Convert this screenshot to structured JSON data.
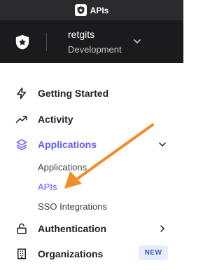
{
  "window": {
    "title": "APIs"
  },
  "tenant": {
    "name": "retgits",
    "environment": "Development"
  },
  "nav": {
    "items": [
      {
        "label": "Getting Started",
        "icon": "lightning-icon"
      },
      {
        "label": "Activity",
        "icon": "trending-up-icon"
      },
      {
        "label": "Applications",
        "icon": "layers-icon",
        "expanded": true,
        "active": true
      },
      {
        "label": "Authentication",
        "icon": "lock-icon",
        "expanded": false
      },
      {
        "label": "Organizations",
        "icon": "building-icon",
        "badge": "NEW"
      }
    ],
    "subitems": [
      {
        "label": "Applications"
      },
      {
        "label": "APIs",
        "active": true
      },
      {
        "label": "SSO Integrations"
      }
    ]
  },
  "colors": {
    "accent": "#635dff",
    "annotation_arrow": "#f28c28",
    "sidebar_dark": "#1b1b1d"
  }
}
